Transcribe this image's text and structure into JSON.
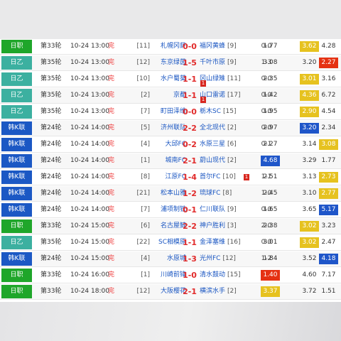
{
  "colors": {
    "league_green": "#1fa62a",
    "league_teal": "#3cb0a0",
    "league_blue": "#1b58c4",
    "odds_yellow": "#e6c21f",
    "odds_blue": "#1f56c9",
    "odds_red": "#e53112"
  },
  "rows": [
    {
      "league": "日职",
      "lc": "green",
      "round": "第33轮",
      "time": "10-24 13:00",
      "live": "完",
      "hrank": "[11]",
      "home": "札幌冈萨",
      "score": "0-0",
      "away": "福冈黄蜂",
      "arank": "[9]",
      "ht": "0-0",
      "o1": "1.77",
      "o2": "3.62",
      "o3": "4.28",
      "hi": 2,
      "hc": "yellow"
    },
    {
      "league": "日乙",
      "lc": "teal",
      "round": "第35轮",
      "time": "10-24 13:00",
      "live": "完",
      "hrank": "[12]",
      "home": "东京绿茵",
      "score": "1-5",
      "away": "千叶市原",
      "arank": "[9]",
      "ht": "1-3",
      "o1": "3.08",
      "o2": "3.20",
      "o3": "2.27",
      "hi": 3,
      "hc": "red"
    },
    {
      "league": "日乙",
      "lc": "teal",
      "round": "第35轮",
      "time": "10-24 13:00",
      "live": "完",
      "hrank": "[10]",
      "home": "水户蜀葵",
      "score": "1-1",
      "away": "冈山绿雉",
      "arank": "[11]",
      "ht": "0-0",
      "o1": "2.35",
      "o2": "3.01",
      "o3": "3.16",
      "hi": 2,
      "hc": "yellow",
      "redcard": "1"
    },
    {
      "league": "日乙",
      "lc": "teal",
      "round": "第35轮",
      "time": "10-24 13:00",
      "live": "完",
      "hrank": "[2]",
      "home": "京都",
      "score": "1-1",
      "away": "山口雷诺",
      "arank": "[17]",
      "ht": "0-0",
      "o1": "1.42",
      "o2": "4.36",
      "o3": "6.72",
      "hi": 2,
      "hc": "yellow",
      "redcard": "1"
    },
    {
      "league": "日乙",
      "lc": "teal",
      "round": "第35轮",
      "time": "10-24 13:00",
      "live": "完",
      "hrank": "[7]",
      "home": "町田泽维",
      "score": "0-0",
      "away": "栃木SC",
      "arank": "[15]",
      "ht": "0-0",
      "o1": "1.95",
      "o2": "2.90",
      "o3": "4.54",
      "hi": 2,
      "hc": "yellow"
    },
    {
      "league": "韩K联",
      "lc": "blue",
      "round": "第24轮",
      "time": "10-24 14:00",
      "live": "完",
      "hrank": "[5]",
      "home": "济州联队",
      "score": "2-2",
      "away": "全北现代",
      "arank": "[2]",
      "ht": "0-0",
      "o1": "2.97",
      "o2": "3.20",
      "o3": "2.34",
      "hi": 2,
      "hc": "blue"
    },
    {
      "league": "韩K联",
      "lc": "blue",
      "round": "第24轮",
      "time": "10-24 14:00",
      "live": "完",
      "hrank": "[4]",
      "home": "大邱FC",
      "score": "0-2",
      "away": "水原三星",
      "arank": "[6]",
      "ht": "0-1",
      "o1": "2.27",
      "o2": "3.14",
      "o3": "3.08",
      "hi": 3,
      "hc": "yellow"
    },
    {
      "league": "韩K联",
      "lc": "blue",
      "round": "第24轮",
      "time": "10-24 14:00",
      "live": "完",
      "hrank": "[1]",
      "home": "城南FC",
      "score": "2-1",
      "away": "蔚山现代",
      "arank": "[2]",
      "ht": "1-0",
      "o1": "4.68",
      "o2": "3.29",
      "o3": "1.77",
      "hi": 1,
      "hc": "blue"
    },
    {
      "league": "韩K联",
      "lc": "blue",
      "round": "第24轮",
      "time": "10-24 14:00",
      "live": "完",
      "hrank": "[8]",
      "home": "江原FC",
      "score": "1-4",
      "away": "首尔FC",
      "arank": "[10]",
      "ht": "1-1",
      "o1": "2.51",
      "o2": "3.13",
      "o3": "2.73",
      "hi": 3,
      "hc": "yellow",
      "redcard2": "1"
    },
    {
      "league": "韩K联",
      "lc": "blue",
      "round": "第24轮",
      "time": "10-24 14:00",
      "live": "完",
      "hrank": "[21]",
      "home": "松本山雅",
      "score": "1-2",
      "away": "琉球FC",
      "arank": "[8]",
      "ht": "1-0",
      "o1": "2.45",
      "o2": "3.10",
      "o3": "2.77",
      "hi": 3,
      "hc": "yellow"
    },
    {
      "league": "韩K联",
      "lc": "blue",
      "round": "第24轮",
      "time": "10-24 14:00",
      "live": "完",
      "hrank": "[7]",
      "home": "浦项制铁",
      "score": "0-1",
      "away": "仁川联队",
      "arank": "[9]",
      "ht": "0-0",
      "o1": "1.65",
      "o2": "3.65",
      "o3": "5.17",
      "hi": 3,
      "hc": "blue"
    },
    {
      "league": "日职",
      "lc": "green",
      "round": "第33轮",
      "time": "10-24 15:00",
      "live": "完",
      "hrank": "[6]",
      "home": "名古屋鲸",
      "score": "2-2",
      "away": "神户胜利",
      "arank": "[3]",
      "ht": "2-0",
      "o1": "2.38",
      "o2": "3.02",
      "o3": "3.23",
      "hi": 2,
      "hc": "yellow"
    },
    {
      "league": "日乙",
      "lc": "teal",
      "round": "第35轮",
      "time": "10-24 15:00",
      "live": "完",
      "hrank": "[22]",
      "home": "SC相模原",
      "score": "1-1",
      "away": "金泽塞维",
      "arank": "[16]",
      "ht": "0-0",
      "o1": "3.01",
      "o2": "3.02",
      "o3": "2.47",
      "hi": 2,
      "hc": "yellow"
    },
    {
      "league": "韩K联",
      "lc": "blue",
      "round": "第24轮",
      "time": "10-24 15:00",
      "live": "完",
      "hrank": "[4]",
      "home": "水原城",
      "score": "1-3",
      "away": "光州FC",
      "arank": "[12]",
      "ht": "1-2",
      "o1": "1.84",
      "o2": "3.52",
      "o3": "4.18",
      "hi": 3,
      "hc": "blue"
    },
    {
      "league": "日职",
      "lc": "green",
      "round": "第33轮",
      "time": "10-24 16:00",
      "live": "完",
      "hrank": "[1]",
      "home": "川崎前锋",
      "score": "1-0",
      "away": "清水鼓动",
      "arank": "[15]",
      "ht": "0-0",
      "o1": "1.40",
      "o2": "4.60",
      "o3": "7.17",
      "hi": 1,
      "hc": "red"
    },
    {
      "league": "日职",
      "lc": "green",
      "round": "第33轮",
      "time": "10-24 18:00",
      "live": "完",
      "hrank": "[12]",
      "home": "大阪樱花",
      "score": "2-1",
      "away": "横滨水手",
      "arank": "[2]",
      "ht": "2-1",
      "o1": "3.37",
      "o2": "3.72",
      "o3": "1.51",
      "hi": 1,
      "hc": "yellow"
    }
  ]
}
